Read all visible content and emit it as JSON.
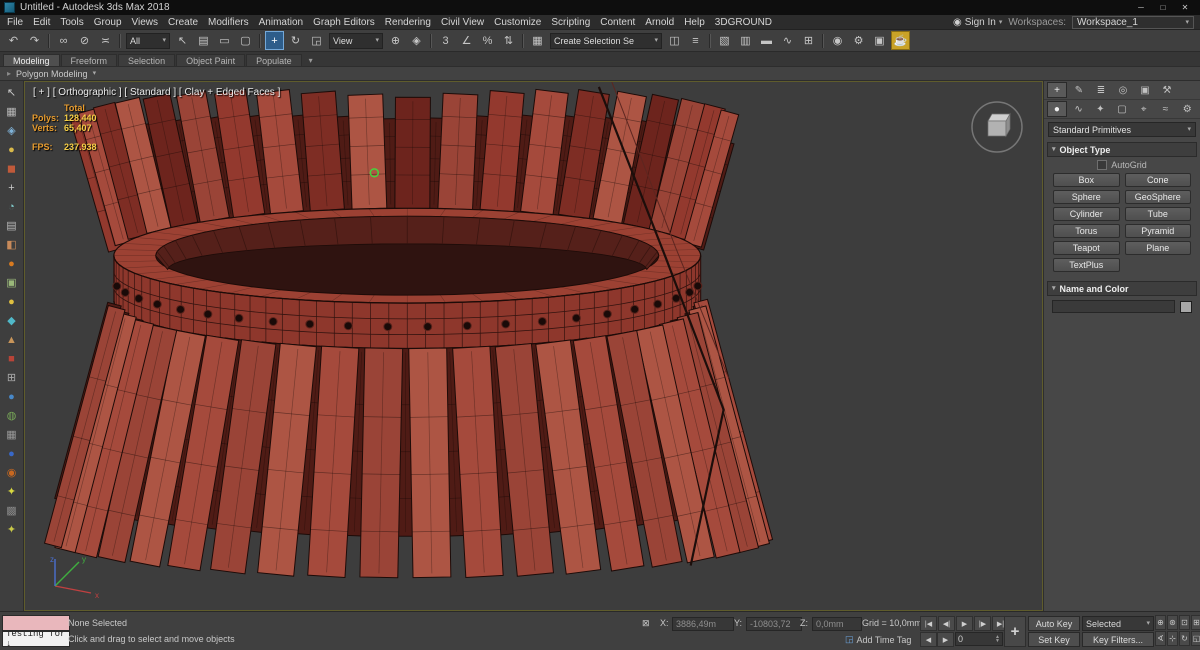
{
  "titlebar": {
    "title": "Untitled - Autodesk 3ds Max 2018",
    "minimize": "─",
    "maximize": "□",
    "close": "✕"
  },
  "menubar": {
    "items": [
      "File",
      "Edit",
      "Tools",
      "Group",
      "Views",
      "Create",
      "Modifiers",
      "Animation",
      "Graph Editors",
      "Rendering",
      "Civil View",
      "Customize",
      "Scripting",
      "Content",
      "Arnold",
      "Help",
      "3DGROUND"
    ],
    "sign_in": "Sign In",
    "workspaces_label": "Workspaces:",
    "workspace_value": "Workspace_1"
  },
  "toolbar": {
    "items": [
      {
        "type": "icon",
        "name": "undo-icon",
        "glyph": "↶"
      },
      {
        "type": "icon",
        "name": "redo-icon",
        "glyph": "↷"
      },
      {
        "type": "sep"
      },
      {
        "type": "icon",
        "name": "select-and-link-icon",
        "glyph": "∞"
      },
      {
        "type": "icon",
        "name": "unlink-selection-icon",
        "glyph": "⊘"
      },
      {
        "type": "icon",
        "name": "bind-to-space-warp-icon",
        "glyph": "≍"
      },
      {
        "type": "sep"
      },
      {
        "type": "dropdown",
        "name": "selection-filter-dropdown",
        "label": "All"
      },
      {
        "type": "icon",
        "name": "select-object-icon",
        "glyph": "↖"
      },
      {
        "type": "icon",
        "name": "select-by-name-icon",
        "glyph": "▤"
      },
      {
        "type": "icon",
        "name": "rectangular-selection-region-icon",
        "glyph": "▭"
      },
      {
        "type": "icon",
        "name": "window-crossing-icon",
        "glyph": "▢"
      },
      {
        "type": "sep"
      },
      {
        "type": "icon",
        "name": "select-and-move-icon",
        "glyph": "+",
        "active": true
      },
      {
        "type": "icon",
        "name": "select-and-rotate-icon",
        "glyph": "↻"
      },
      {
        "type": "icon",
        "name": "select-and-scale-icon",
        "glyph": "◲"
      },
      {
        "type": "dropdown",
        "name": "reference-coordinate-dropdown",
        "label": "View"
      },
      {
        "type": "icon",
        "name": "use-pivot-point-center-icon",
        "glyph": "⊕"
      },
      {
        "type": "icon",
        "name": "select-and-manipulate-icon",
        "glyph": "◈"
      },
      {
        "type": "sep"
      },
      {
        "type": "icon",
        "name": "snap-toggle-3d-icon",
        "glyph": "3"
      },
      {
        "type": "icon",
        "name": "angle-snap-toggle-icon",
        "glyph": "∠"
      },
      {
        "type": "icon",
        "name": "percent-snap-toggle-icon",
        "glyph": "%"
      },
      {
        "type": "icon",
        "name": "spinner-snap-toggle-icon",
        "glyph": "⇅"
      },
      {
        "type": "sep"
      },
      {
        "type": "icon",
        "name": "edit-named-selection-sets-icon",
        "glyph": "▦"
      },
      {
        "type": "dropdown",
        "name": "named-selection-sets-dropdown",
        "label": "Create Selection Se"
      },
      {
        "type": "icon",
        "name": "mirror-icon",
        "glyph": "◫"
      },
      {
        "type": "icon",
        "name": "align-icon",
        "glyph": "≡"
      },
      {
        "type": "sep"
      },
      {
        "type": "icon",
        "name": "toggle-scene-explorer-icon",
        "glyph": "▧"
      },
      {
        "type": "icon",
        "name": "toggle-layer-explorer-icon",
        "glyph": "▥"
      },
      {
        "type": "icon",
        "name": "toggle-ribbon-icon",
        "glyph": "▬"
      },
      {
        "type": "icon",
        "name": "curve-editor-icon",
        "glyph": "∿"
      },
      {
        "type": "icon",
        "name": "schematic-view-icon",
        "glyph": "⊞"
      },
      {
        "type": "sep"
      },
      {
        "type": "icon",
        "name": "material-editor-icon",
        "glyph": "◉"
      },
      {
        "type": "icon",
        "name": "render-setup-icon",
        "glyph": "⚙"
      },
      {
        "type": "icon",
        "name": "rendered-frame-window-icon",
        "glyph": "▣"
      },
      {
        "type": "icon",
        "name": "render-production-icon",
        "glyph": "☕",
        "warn": true
      }
    ]
  },
  "ribbon": {
    "tabs": [
      {
        "label": "Modeling",
        "active": true
      },
      {
        "label": "Freeform"
      },
      {
        "label": "Selection"
      },
      {
        "label": "Object Paint"
      },
      {
        "label": "Populate"
      }
    ],
    "panel_label": "Polygon Modeling"
  },
  "left_toolbar": {
    "icons": [
      {
        "name": "left-tool-select-icon",
        "glyph": "↖",
        "color": "#cccccc"
      },
      {
        "name": "left-tool-grid-icon",
        "glyph": "▦",
        "color": "#b8b8b8"
      },
      {
        "name": "left-tool-gem-icon",
        "glyph": "◈",
        "color": "#7fb2d8"
      },
      {
        "name": "left-tool-sphere-icon",
        "glyph": "●",
        "color": "#d8b94a"
      },
      {
        "name": "left-tool-block-icon",
        "glyph": "◼",
        "color": "#c05a3a"
      },
      {
        "name": "left-tool-add-icon",
        "glyph": "+",
        "color": "#cccccc"
      },
      {
        "name": "left-tool-arc-icon",
        "glyph": "◔",
        "color": "#7fc8c8"
      },
      {
        "name": "left-tool-list-icon",
        "glyph": "▤",
        "color": "#b8b8b8"
      },
      {
        "name": "left-tool-half-icon",
        "glyph": "◧",
        "color": "#c88a5a"
      },
      {
        "name": "left-tool-dot-icon",
        "glyph": "●",
        "color": "#d87a20"
      },
      {
        "name": "left-tool-panel-icon",
        "glyph": "▣",
        "color": "#9ab87a"
      },
      {
        "name": "left-tool-ball-icon",
        "glyph": "●",
        "color": "#e0c040"
      },
      {
        "name": "left-tool-diamond-icon",
        "glyph": "◆",
        "color": "#50b8c8"
      },
      {
        "name": "left-tool-tri-icon",
        "glyph": "▲",
        "color": "#c8955a"
      },
      {
        "name": "left-tool-square-icon",
        "glyph": "■",
        "color": "#b84438"
      },
      {
        "name": "left-tool-plusbox-icon",
        "glyph": "⊞",
        "color": "#aaaaaa"
      },
      {
        "name": "left-tool-bluedot-icon",
        "glyph": "●",
        "color": "#4888c8"
      },
      {
        "name": "left-tool-leaf-icon",
        "glyph": "◍",
        "color": "#78a858"
      },
      {
        "name": "left-tool-mesh-icon",
        "glyph": "▦",
        "color": "#999999"
      },
      {
        "name": "left-tool-navy-icon",
        "glyph": "●",
        "color": "#3868c8"
      },
      {
        "name": "left-tool-target-icon",
        "glyph": "◉",
        "color": "#c86820"
      },
      {
        "name": "left-tool-bright-icon",
        "glyph": "✦",
        "color": "#d8d840"
      },
      {
        "name": "left-tool-hatch-icon",
        "glyph": "▩",
        "color": "#888888"
      },
      {
        "name": "left-tool-star-icon",
        "glyph": "✦",
        "color": "#c8c848"
      }
    ]
  },
  "viewport": {
    "label": "[ + ]  [ Orthographic ]  [ Standard ]  [ Clay + Edged Faces ]",
    "stats": {
      "total_label": "Total",
      "polys_label": "Polys:",
      "polys_value": "128,440",
      "verts_label": "Verts:",
      "verts_value": "65,407",
      "fps_label": "FPS:",
      "fps_value": "237.938"
    },
    "axis": {
      "x": "x",
      "y": "y",
      "z": "z"
    },
    "model": {
      "bg": "#3d3d3d",
      "palette": [
        "#93392e",
        "#a54a3c",
        "#7e2d24",
        "#ad5544",
        "#6d241d",
        "#9a4437"
      ],
      "dark": "#4f1b15",
      "edge": "#1d0b08",
      "interior": "#2f1310",
      "wall": "#55201a",
      "band": "#8e372c",
      "top": "#9c4133",
      "bolt": "#190a08",
      "marker": "#46d43e"
    }
  },
  "command_panel": {
    "tabs": [
      {
        "name": "tab-create",
        "glyph": "+",
        "active": true
      },
      {
        "name": "tab-modify",
        "glyph": "✎"
      },
      {
        "name": "tab-hierarchy",
        "glyph": "≣"
      },
      {
        "name": "tab-motion",
        "glyph": "◎"
      },
      {
        "name": "tab-display",
        "glyph": "▣"
      },
      {
        "name": "tab-utilities",
        "glyph": "⚒"
      }
    ],
    "categories": [
      {
        "name": "category-geometry",
        "glyph": "●",
        "active": true
      },
      {
        "name": "category-shapes",
        "glyph": "∿"
      },
      {
        "name": "category-lights",
        "glyph": "✦"
      },
      {
        "name": "category-cameras",
        "glyph": "▢"
      },
      {
        "name": "category-helpers",
        "glyph": "⌖"
      },
      {
        "name": "category-space-warps",
        "glyph": "≈"
      },
      {
        "name": "category-systems",
        "glyph": "⚙"
      }
    ],
    "category_dropdown": "Standard Primitives",
    "object_type_label": "Object Type",
    "autogrid_label": "AutoGrid",
    "object_buttons": [
      "Box",
      "Cone",
      "Sphere",
      "GeoSphere",
      "Cylinder",
      "Tube",
      "Torus",
      "Pyramid",
      "Teapot",
      "Plane",
      "TextPlus"
    ],
    "name_color_label": "Name and Color"
  },
  "status_bar": {
    "listener_text": "Testing for ↓",
    "selection_status": "None Selected",
    "prompt": "Click and drag to select and move objects",
    "lock_glyph": "⊠",
    "x_label": "X:",
    "x_value": "3886,49m",
    "y_label": "Y:",
    "y_value": "-10803,72",
    "z_label": "Z:",
    "z_value": "0,0mm",
    "grid_label": "Grid = 10,0mm",
    "time_tag_icon": "◲",
    "time_tag_label": "Add Time Tag",
    "transport": [
      {
        "name": "go-to-start-button",
        "glyph": "|◀"
      },
      {
        "name": "previous-frame-button",
        "glyph": "◀|"
      },
      {
        "name": "play-button",
        "glyph": "▶"
      },
      {
        "name": "next-frame-button",
        "glyph": "|▶"
      },
      {
        "name": "go-to-end-button",
        "glyph": "▶|"
      }
    ],
    "key_prev_glyph": "◀",
    "key_next_glyph": "▶",
    "frame_value": "0",
    "big_key_glyph": "+",
    "auto_key_label": "Auto Key",
    "set_key_label": "Set Key",
    "selected_dropdown": "Selected",
    "key_filters_label": "Key Filters...",
    "nav_icons": [
      {
        "name": "zoom-icon",
        "glyph": "⊕"
      },
      {
        "name": "zoom-all-icon",
        "glyph": "⊛"
      },
      {
        "name": "zoom-extents-icon",
        "glyph": "⊡"
      },
      {
        "name": "zoom-extents-all-icon",
        "glyph": "⊞"
      },
      {
        "name": "field-of-view-icon",
        "glyph": "∢"
      },
      {
        "name": "pan-icon",
        "glyph": "⊹"
      },
      {
        "name": "orbit-icon",
        "glyph": "↻"
      },
      {
        "name": "maximize-viewport-toggle-icon",
        "glyph": "◱"
      }
    ]
  }
}
